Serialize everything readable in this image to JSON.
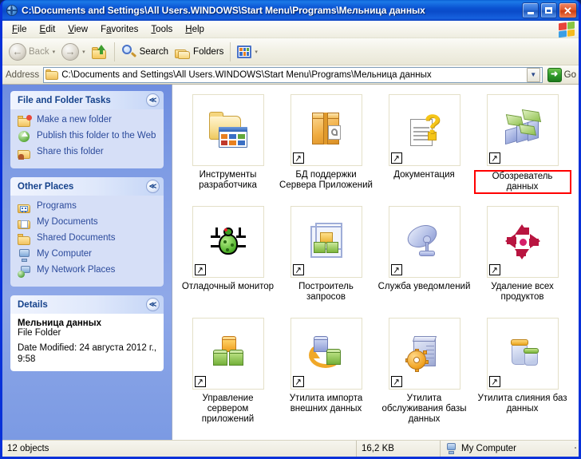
{
  "window": {
    "title": "C:\\Documents and Settings\\All Users.WINDOWS\\Start Menu\\Programs\\Мельница данных",
    "minimize_label": "_",
    "maximize_label": "",
    "close_label": "✕"
  },
  "menubar": {
    "items": [
      {
        "label": "File",
        "accel": "F",
        "rest": "ile"
      },
      {
        "label": "Edit",
        "accel": "E",
        "rest": "dit"
      },
      {
        "label": "View",
        "accel": "V",
        "rest": "iew"
      },
      {
        "label": "Favorites",
        "accel": "a",
        "pre": "F",
        "rest": "vorites"
      },
      {
        "label": "Tools",
        "accel": "T",
        "rest": "ools"
      },
      {
        "label": "Help",
        "accel": "H",
        "rest": "elp"
      }
    ]
  },
  "toolbar": {
    "back_label": "Back",
    "search_label": "Search",
    "folders_label": "Folders",
    "back_arrow": "←",
    "forward_arrow": "→",
    "dropdown_caret": "▾"
  },
  "address": {
    "label": "Address",
    "value": "C:\\Documents and Settings\\All Users.WINDOWS\\Start Menu\\Programs\\Мельница данных",
    "dropdown_caret": "▼",
    "go_label": "Go",
    "go_arrow": "➜"
  },
  "sidebar": {
    "panels": [
      {
        "title": "File and Folder Tasks",
        "collapse_glyph": "≪",
        "items": [
          {
            "label": "Make a new folder",
            "icon": "new-folder-icon"
          },
          {
            "label": "Publish this folder to the Web",
            "icon": "publish-web-icon"
          },
          {
            "label": "Share this folder",
            "icon": "share-folder-icon"
          }
        ]
      },
      {
        "title": "Other Places",
        "collapse_glyph": "≪",
        "items": [
          {
            "label": "Programs",
            "icon": "programs-folder-icon"
          },
          {
            "label": "My Documents",
            "icon": "my-documents-icon"
          },
          {
            "label": "Shared Documents",
            "icon": "shared-documents-icon"
          },
          {
            "label": "My Computer",
            "icon": "my-computer-icon"
          },
          {
            "label": "My Network Places",
            "icon": "my-network-places-icon"
          }
        ]
      }
    ],
    "details": {
      "title": "Details",
      "collapse_glyph": "≪",
      "name": "Мельница данных",
      "type": "File Folder",
      "date_modified": "Date Modified: 24 августа 2012 г., 9:58"
    }
  },
  "files": [
    {
      "label": "Инструменты разработчика",
      "icon": "developer-tools-folder-icon",
      "shortcut": false,
      "highlighted": false
    },
    {
      "label": "БД поддержки Сервера Приложений",
      "icon": "app-server-db-package-icon",
      "shortcut": true,
      "highlighted": false
    },
    {
      "label": "Документация",
      "icon": "documentation-help-icon",
      "shortcut": true,
      "highlighted": false
    },
    {
      "label": "Обозреватель данных",
      "icon": "data-explorer-icon",
      "shortcut": true,
      "highlighted": true
    },
    {
      "label": "Отладочный монитор",
      "icon": "debug-monitor-bug-icon",
      "shortcut": true,
      "highlighted": false
    },
    {
      "label": "Построитель запросов",
      "icon": "query-builder-cube-icon",
      "shortcut": true,
      "highlighted": false
    },
    {
      "label": "Служба уведомлений",
      "icon": "notification-service-dish-icon",
      "shortcut": true,
      "highlighted": false
    },
    {
      "label": "Удаление всех продуктов",
      "icon": "remove-all-products-icon",
      "shortcut": true,
      "highlighted": false
    },
    {
      "label": "Управление сервером приложений",
      "icon": "app-server-management-lego-icon",
      "shortcut": true,
      "highlighted": false
    },
    {
      "label": "Утилита импорта внешних данных",
      "icon": "external-data-import-icon",
      "shortcut": true,
      "highlighted": false
    },
    {
      "label": "Утилита обслуживания базы данных",
      "icon": "db-maintenance-server-gear-icon",
      "shortcut": true,
      "highlighted": false
    },
    {
      "label": "Утилита слияния баз данных",
      "icon": "db-merge-jars-icon",
      "shortcut": true,
      "highlighted": false
    }
  ],
  "statusbar": {
    "object_count": "12 objects",
    "size": "16,2 KB",
    "location": "My Computer"
  },
  "colors": {
    "title_blue": "#0831d9",
    "sidebar_blue": "#7f9ce4",
    "panel_body": "#d6dff7",
    "link_blue": "#2b4a9b",
    "highlight_red": "#ff0000",
    "go_green": "#2f9b2a"
  }
}
